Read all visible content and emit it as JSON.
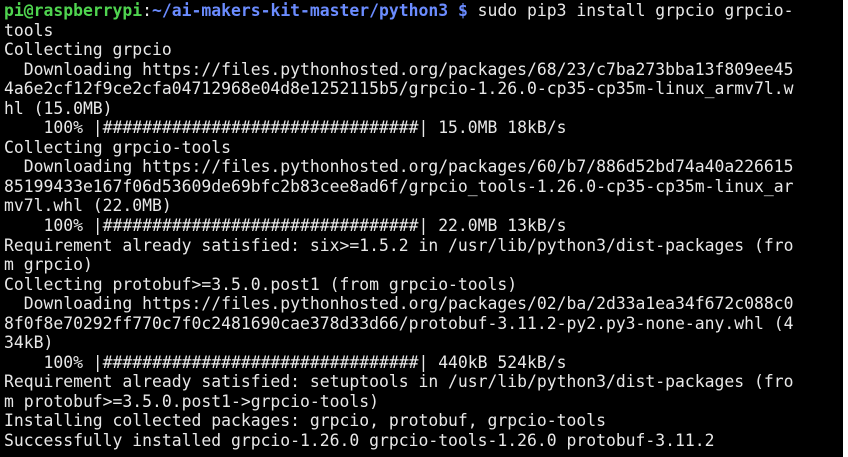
{
  "prompt": {
    "user_host": "pi@raspberrypi",
    "colon": ":",
    "path": "~/ai-makers-kit-master/python3 $",
    "command": " sudo pip3 install grpcio grpcio-"
  },
  "lines": [
    "tools",
    "Collecting grpcio",
    "  Downloading https://files.pythonhosted.org/packages/68/23/c7ba273bba13f809ee45",
    "4a6e2cf12f9ce2cfa04712968e04d8e1252115b5/grpcio-1.26.0-cp35-cp35m-linux_armv7l.w",
    "hl (15.0MB)",
    "    100% |################################| 15.0MB 18kB/s",
    "Collecting grpcio-tools",
    "  Downloading https://files.pythonhosted.org/packages/60/b7/886d52bd74a40a226615",
    "85199433e167f06d53609de69bfc2b83cee8ad6f/grpcio_tools-1.26.0-cp35-cp35m-linux_ar",
    "mv7l.whl (22.0MB)",
    "    100% |################################| 22.0MB 13kB/s",
    "Requirement already satisfied: six>=1.5.2 in /usr/lib/python3/dist-packages (fro",
    "m grpcio)",
    "Collecting protobuf>=3.5.0.post1 (from grpcio-tools)",
    "  Downloading https://files.pythonhosted.org/packages/02/ba/2d33a1ea34f672c088c0",
    "8f0f8e70292ff770c7f0c2481690cae378d33d66/protobuf-3.11.2-py2.py3-none-any.whl (4",
    "34kB)",
    "    100% |################################| 440kB 524kB/s",
    "Requirement already satisfied: setuptools in /usr/lib/python3/dist-packages (fro",
    "m protobuf>=3.5.0.post1->grpcio-tools)",
    "Installing collected packages: grpcio, protobuf, grpcio-tools",
    "Successfully installed grpcio-1.26.0 grpcio-tools-1.26.0 protobuf-3.11.2"
  ],
  "colors": {
    "background": "#000000",
    "text": "#e8e8e8",
    "user_host": "#4fd44f",
    "path": "#6b8cff"
  }
}
